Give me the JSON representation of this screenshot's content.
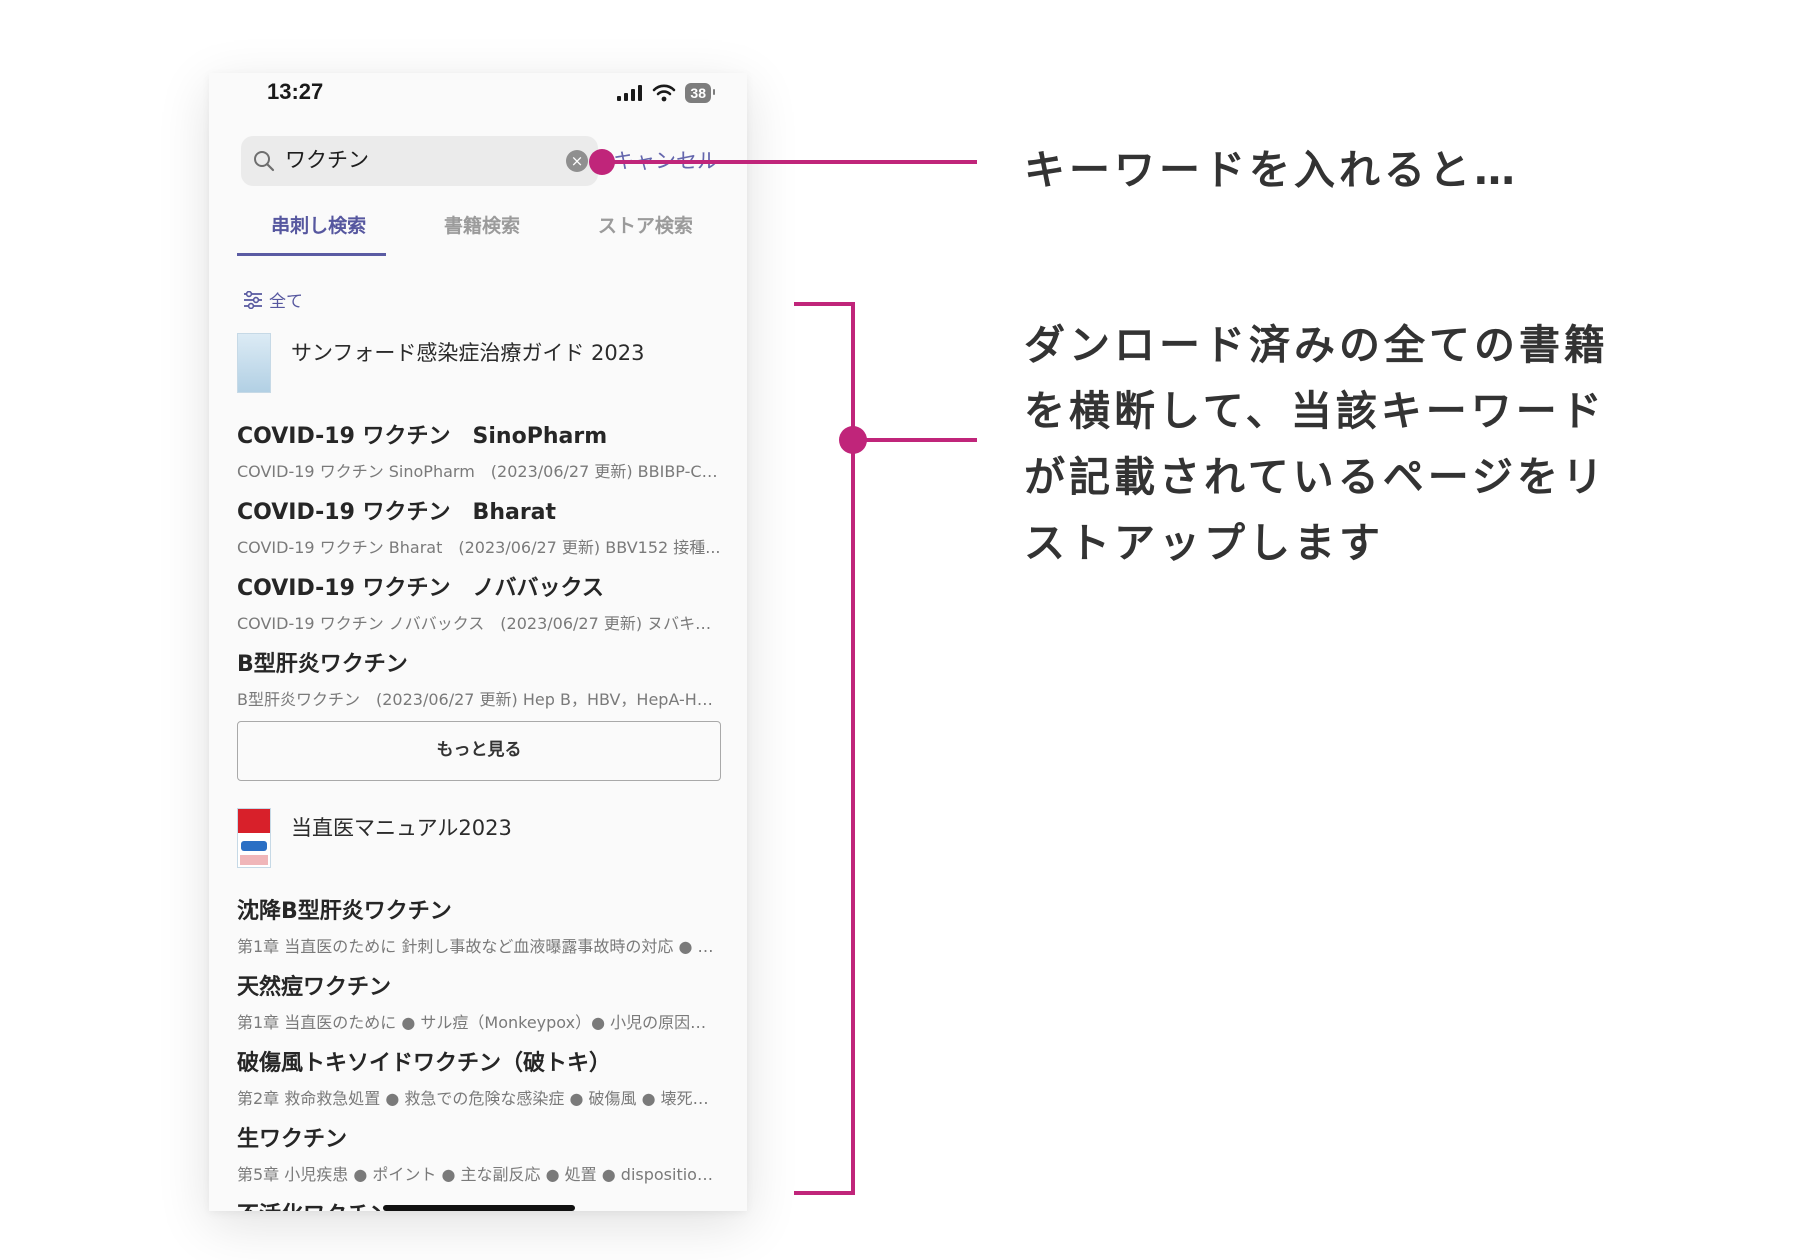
{
  "status_bar": {
    "time": "13:27",
    "battery": "38"
  },
  "search": {
    "query": "ワクチン",
    "clear_label": "×",
    "cancel_label": "キャンセル"
  },
  "tabs": [
    {
      "label": "串刺し検索"
    },
    {
      "label": "書籍検索"
    },
    {
      "label": "ストア検索"
    }
  ],
  "filter": {
    "label": "全て"
  },
  "books": [
    {
      "title": "サンフォード感染症治療ガイド 2023",
      "results": [
        {
          "title": "COVID-19 ワクチン　SinoPharm",
          "subtitle": "COVID-19 ワクチン SinoPharm　(2023/06/27 更新) BBIBP-Co..."
        },
        {
          "title": "COVID-19 ワクチン　Bharat",
          "subtitle": "COVID-19 ワクチン Bharat　(2023/06/27 更新) BBV152 接種..."
        },
        {
          "title": "COVID-19 ワクチン　ノババックス",
          "subtitle": "COVID-19 ワクチン ノババックス　(2023/06/27 更新) ヌバキソ…"
        },
        {
          "title": "B型肝炎ワクチン",
          "subtitle": "B型肝炎ワクチン　(2023/06/27 更新) Hep B，HBV，HepA-He..."
        }
      ],
      "more_label": "もっと見る"
    },
    {
      "title": "当直医マニュアル2023",
      "results": [
        {
          "title": "沈降B型肝炎ワクチン",
          "subtitle": "第1章 当直医のために 針刺し事故など血液曝露事故時の対応 ● ポ…"
        },
        {
          "title": "天然痘ワクチン",
          "subtitle": "第1章 当直医のために ● サル痘（Monkeypox）● 小児の原因不…"
        },
        {
          "title": "破傷風トキソイドワクチン（破トキ）",
          "subtitle": "第2章 救命救急処置 ● 救急での危険な感染症 ● 破傷風 ● 壊死性…"
        },
        {
          "title": "生ワクチン",
          "subtitle": "第5章 小児疾患 ● ポイント ● 主な副反応 ● 処置 ● disposition..."
        },
        {
          "title": "不活化ワクチン",
          "subtitle": ""
        }
      ]
    }
  ],
  "annotations": {
    "first": "キーワードを入れると…",
    "second_lines": [
      "ダンロード済みの全ての書籍",
      "を横断して、当該キーワード",
      "が記載されているページをリ",
      "ストアップします"
    ]
  },
  "colors": {
    "accent": "#c0257a",
    "tab_active": "#56579f",
    "cancel": "#6466ad"
  }
}
